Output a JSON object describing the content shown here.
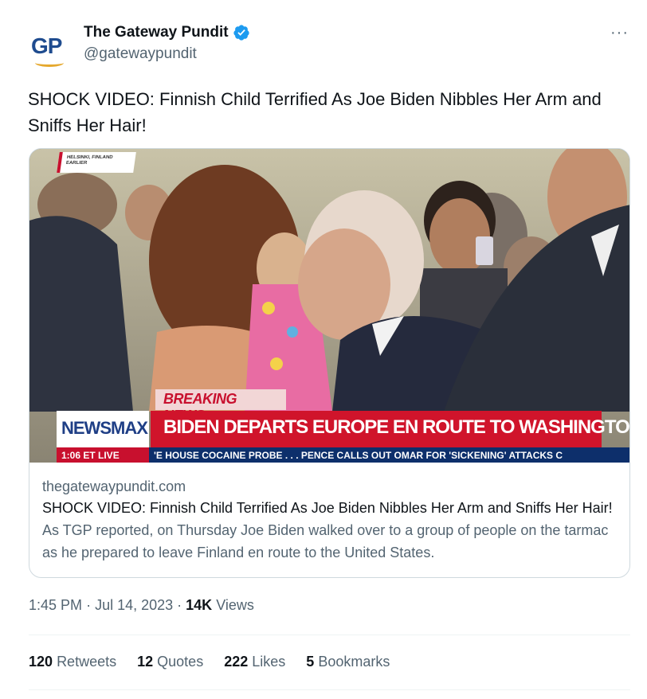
{
  "author": {
    "avatar_text": "GP",
    "display_name": "The Gateway Pundit",
    "handle": "@gatewaypundit",
    "verified": true,
    "brand_color": "#1f4c8f",
    "verified_color": "#1d9bf0"
  },
  "more_label": "···",
  "tweet": {
    "text": "SHOCK VIDEO: Finnish Child Terrified As Joe Biden Nibbles Her Arm and Sniffs Her Hair!"
  },
  "card": {
    "media": {
      "location_tag": "HELSINKI, FINLAND EARLIER",
      "breaking_label": "BREAKING NEWS",
      "network_logo": "NEWSMAX",
      "headline": "BIDEN DEPARTS EUROPE EN ROUTE TO WASHINGTON",
      "ticker_time": "1:06 ET   LIVE",
      "ticker_text": "'E HOUSE COCAINE PROBE . . .      PENCE CALLS OUT OMAR FOR 'SICKENING' ATTACKS C"
    },
    "domain": "thegatewaypundit.com",
    "title": "SHOCK VIDEO: Finnish Child Terrified As Joe Biden Nibbles Her Arm and Sniffs Her Hair!",
    "description": "As TGP reported, on Thursday Joe Biden walked over to a group of people on the tarmac as he prepared to leave Finland en route to the United States."
  },
  "meta": {
    "time": "1:45 PM",
    "date": "Jul 14, 2023",
    "views_count": "14K",
    "views_label": "Views"
  },
  "stats": [
    {
      "count": "120",
      "label": "Retweets"
    },
    {
      "count": "12",
      "label": "Quotes"
    },
    {
      "count": "222",
      "label": "Likes"
    },
    {
      "count": "5",
      "label": "Bookmarks"
    }
  ]
}
